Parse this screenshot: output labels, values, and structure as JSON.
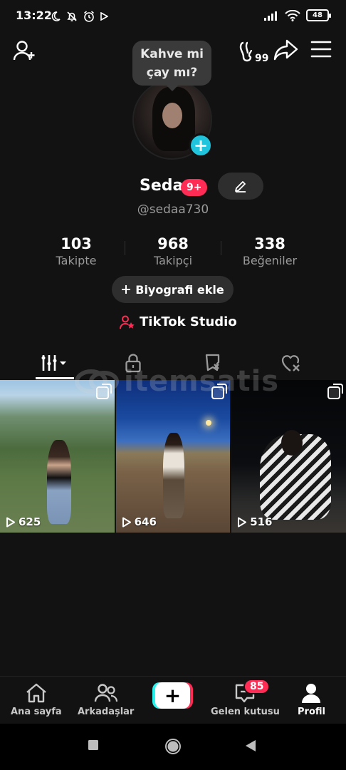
{
  "status_bar": {
    "time": "13:22",
    "battery": "48",
    "icons": [
      "moon-icon",
      "bell-off-icon",
      "alarm-icon",
      "play-store-icon",
      "signal-icon",
      "wifi-icon",
      "battery-icon"
    ]
  },
  "top_bar": {
    "icons": [
      "add-friend-icon",
      "profile-visitors-icon",
      "share-icon",
      "menu-icon"
    ],
    "visitors_count": "99"
  },
  "note": {
    "line1": "Kahve mi",
    "line2": "çay mı?"
  },
  "profile": {
    "name": "Seda",
    "name_badge": "9+",
    "username": "@sedaa730"
  },
  "stats": [
    {
      "value": "103",
      "label": "Takipte"
    },
    {
      "value": "968",
      "label": "Takipçi"
    },
    {
      "value": "338",
      "label": "Beğeniler"
    }
  ],
  "bio_button": "Biyografi ekle",
  "studio_link": "TikTok Studio",
  "tabs": [
    {
      "icon": "videos-grid-icon",
      "active": true
    },
    {
      "icon": "lock-icon",
      "active": false
    },
    {
      "icon": "favorites-icon",
      "active": false
    },
    {
      "icon": "liked-icon",
      "active": false
    }
  ],
  "watermark": "itemsatis",
  "videos": [
    {
      "views": "625"
    },
    {
      "views": "646"
    },
    {
      "views": "516"
    }
  ],
  "bottom_nav": {
    "home": "Ana sayfa",
    "friends": "Arkadaşlar",
    "inbox": "Gelen kutusu",
    "inbox_badge": "85",
    "profile": "Profil",
    "active": "profile"
  },
  "colors": {
    "accent": "#fe2c55",
    "cyan": "#25f4ee",
    "background": "#121212"
  }
}
